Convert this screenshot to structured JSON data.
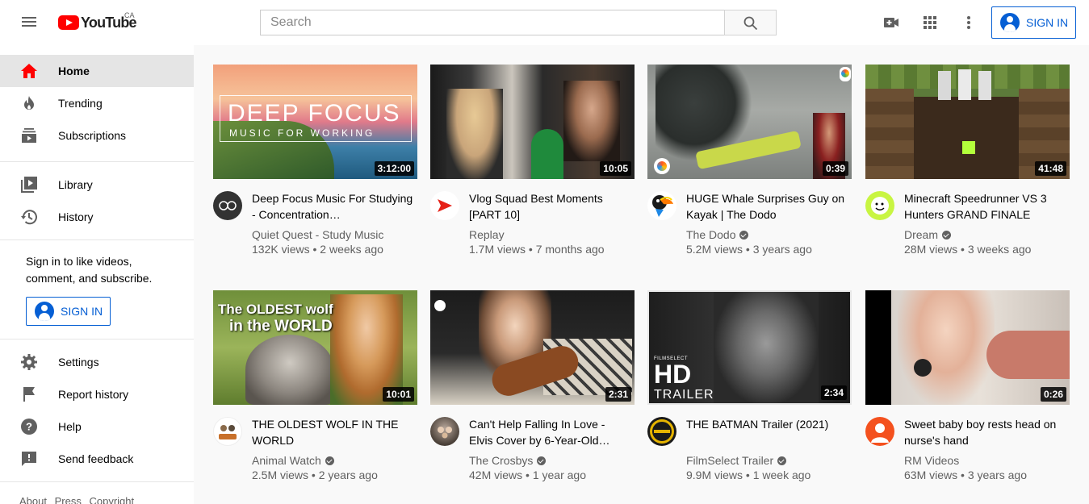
{
  "header": {
    "logo_text": "YouTube",
    "country_code": "CA",
    "search_placeholder": "Search",
    "sign_in_label": "SIGN IN",
    "icons": [
      "menu-icon",
      "create-video-icon",
      "apps-icon",
      "more-vertical-icon",
      "search-icon"
    ]
  },
  "sidebar": {
    "items": [
      {
        "label": "Home",
        "icon": "home-icon",
        "active": true
      },
      {
        "label": "Trending",
        "icon": "fire-icon"
      },
      {
        "label": "Subscriptions",
        "icon": "subscriptions-icon"
      },
      {
        "label": "Library",
        "icon": "library-icon"
      },
      {
        "label": "History",
        "icon": "history-icon"
      }
    ],
    "signin_prompt": "Sign in to like videos, comment, and subscribe.",
    "signin_label": "SIGN IN",
    "secondary": [
      {
        "label": "Settings",
        "icon": "gear-icon"
      },
      {
        "label": "Report history",
        "icon": "flag-icon"
      },
      {
        "label": "Help",
        "icon": "help-icon"
      },
      {
        "label": "Send feedback",
        "icon": "feedback-icon"
      }
    ],
    "footer": [
      "About",
      "Press",
      "Copyright"
    ]
  },
  "colors": {
    "brand_red": "#ff0000",
    "link_blue": "#065fd4",
    "secondary_text": "#606060"
  },
  "videos": [
    {
      "title": "Deep Focus Music For Studying - Concentration…",
      "channel": "Quiet Quest - Study Music",
      "verified": false,
      "views": "132K views",
      "age": "2 weeks ago",
      "duration": "3:12:00",
      "overlay_line1": "DEEP FOCUS",
      "overlay_line2": "MUSIC FOR WORKING"
    },
    {
      "title": "Vlog Squad Best Moments [PART 10]",
      "channel": "Replay",
      "verified": false,
      "views": "1.7M views",
      "age": "7 months ago",
      "duration": "10:05"
    },
    {
      "title": "HUGE Whale Surprises Guy on Kayak | The Dodo",
      "channel": "The Dodo",
      "verified": true,
      "views": "5.2M views",
      "age": "3 years ago",
      "duration": "0:39"
    },
    {
      "title": "Minecraft Speedrunner VS 3 Hunters GRAND FINALE",
      "channel": "Dream",
      "verified": true,
      "views": "28M views",
      "age": "3 weeks ago",
      "duration": "41:48"
    },
    {
      "title": "THE OLDEST WOLF IN THE WORLD",
      "channel": "Animal Watch",
      "verified": true,
      "views": "2.5M views",
      "age": "2 years ago",
      "duration": "10:01",
      "overlay_line1": "The OLDEST wolf",
      "overlay_line2": "in the WORLD"
    },
    {
      "title": "Can't Help Falling In Love - Elvis Cover by 6-Year-Old…",
      "channel": "The Crosbys",
      "verified": true,
      "views": "42M views",
      "age": "1 year ago",
      "duration": "2:31"
    },
    {
      "title": "THE BATMAN Trailer (2021)",
      "channel": "FilmSelect Trailer",
      "verified": true,
      "views": "9.9M views",
      "age": "1 week ago",
      "duration": "2:34",
      "overlay_line1": "HD",
      "overlay_line2": "TRAILER",
      "overlay_brand": "FILMSELECT"
    },
    {
      "title": "Sweet baby boy rests head on nurse's hand",
      "channel": "RM Videos",
      "verified": false,
      "views": "63M views",
      "age": "3 years ago",
      "duration": "0:26"
    }
  ]
}
